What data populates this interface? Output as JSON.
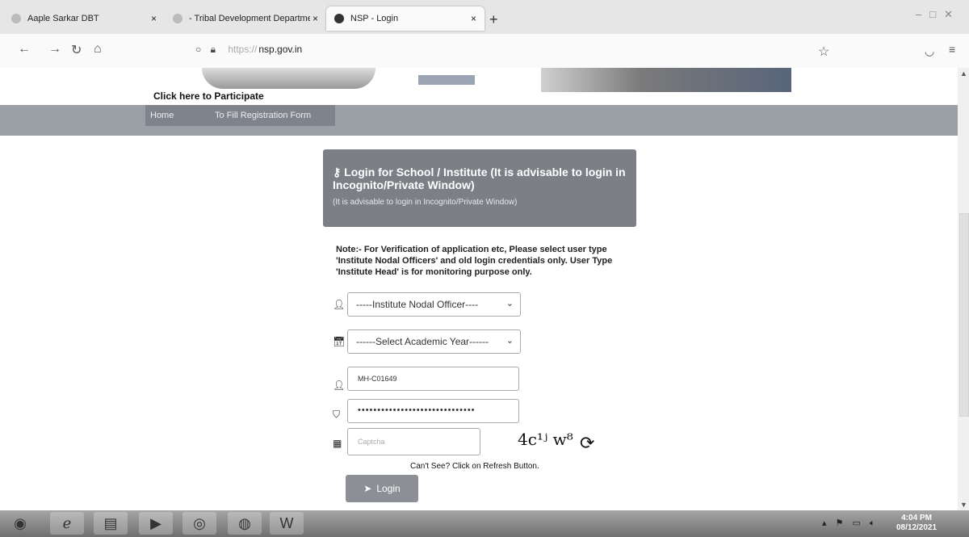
{
  "browser": {
    "tabs": [
      {
        "label": "Aaple Sarkar DBT",
        "close": "×"
      },
      {
        "label": "- Tribal Development Department",
        "close": "×"
      },
      {
        "label": "NSP - Login",
        "close": "×"
      }
    ],
    "new_tab": "+",
    "url_prefix": "https://",
    "url_domain": "nsp.gov.in"
  },
  "page": {
    "participate_link": "Click here to Participate",
    "menu": {
      "home": "Home",
      "registration": "To Fill Registration Form"
    },
    "login_title": "Login for School / Institute (It is advisable to login in Incognito/Private Window)",
    "login_subtitle": "(It is advisable to login in Incognito/Private Window)",
    "note": "Note:- For Verification of application etc, Please select user type 'Institute Nodal Officers' and old login credentials only. User Type 'Institute Head' is for monitoring purpose only.",
    "user_type_value": "-----Institute Nodal Officer----",
    "academic_year_value": "------Select Academic Year------",
    "username_value": "MH-C01649",
    "password_value": "••••••••••••••••••••••••••••••",
    "captcha_placeholder": "Captcha",
    "captcha_text": "4c¹ʲ w⁸",
    "cant_see": "Can't See? Click on Refresh Button.",
    "login_button": "Login"
  },
  "taskbar": {
    "time": "4:04 PM",
    "date": "08/12/2021"
  }
}
